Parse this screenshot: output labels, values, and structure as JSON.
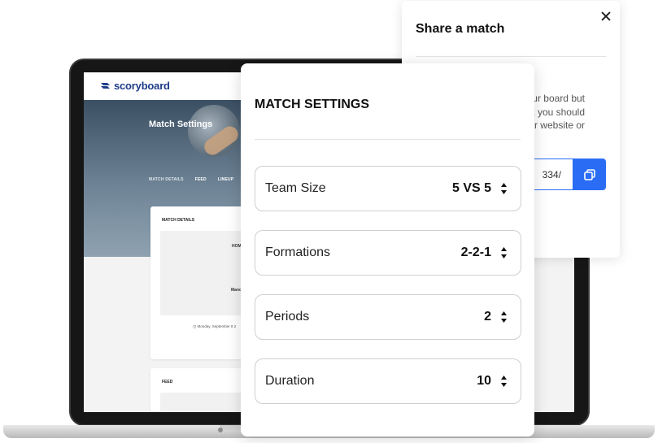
{
  "app": {
    "logo_text": "scoryboard",
    "hero_title": "Match Settings",
    "tabs": [
      "MATCH DETAILS",
      "FEED",
      "LINEUP"
    ],
    "match_details_title": "MATCH DETAILS",
    "home_label": "HOM",
    "team_label": "Manc",
    "date_text": "Monday, September 8 2",
    "feed_title": "FEED"
  },
  "share": {
    "title": "Share a match",
    "description_visible": "y your board but\nk you should\nur website or",
    "link_value": "334/"
  },
  "settings": {
    "title": "MATCH SETTINGS",
    "rows": [
      {
        "label": "Team Size",
        "value": "5 VS 5"
      },
      {
        "label": "Formations",
        "value": "2-2-1"
      },
      {
        "label": "Periods",
        "value": "2"
      },
      {
        "label": "Duration",
        "value": "10"
      }
    ]
  },
  "colors": {
    "accent": "#2a6df4",
    "brand": "#1f3c88"
  }
}
